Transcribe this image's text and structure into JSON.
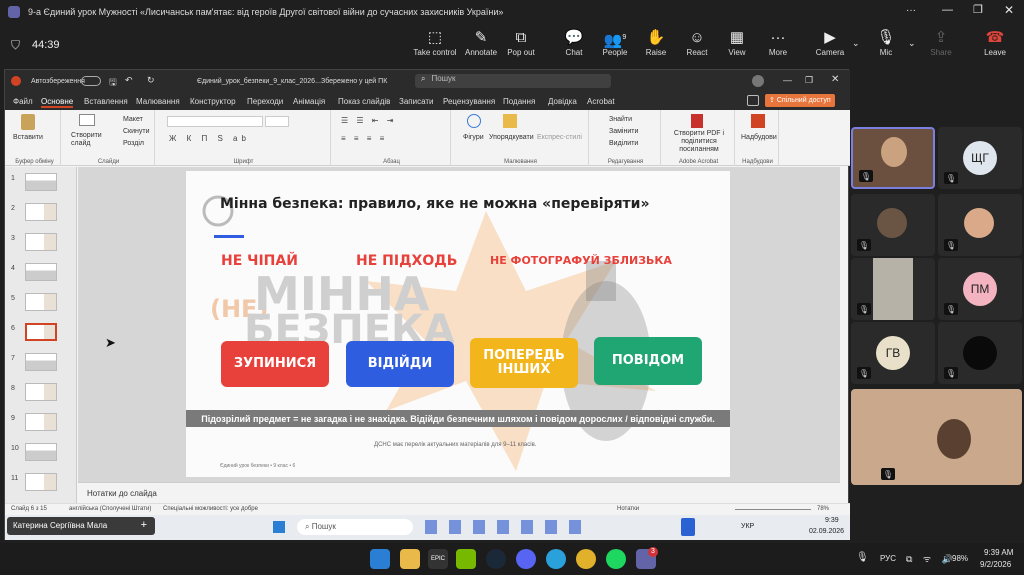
{
  "window": {
    "title": "9-а Єдиний урок Мужності «Лисичанськ пам'ятає: від героїв Другої світової війни до сучасних захисників України»"
  },
  "meeting": {
    "timer": "44:39",
    "buttons": [
      {
        "label": "Take control",
        "icon": "⬚"
      },
      {
        "label": "Annotate",
        "icon": "✎"
      },
      {
        "label": "Pop out",
        "icon": "⧉"
      },
      {
        "label": "Chat",
        "icon": "💬"
      },
      {
        "label": "People",
        "icon": "👥",
        "badge": "9"
      },
      {
        "label": "Raise",
        "icon": "✋"
      },
      {
        "label": "React",
        "icon": "☺"
      },
      {
        "label": "View",
        "icon": "▦"
      },
      {
        "label": "More",
        "icon": "···"
      },
      {
        "label": "Camera",
        "icon": "▶"
      },
      {
        "label": "Mic",
        "icon": "🎙"
      },
      {
        "label": "Share",
        "icon": "⇪"
      },
      {
        "label": "Leave",
        "icon": "☎"
      }
    ]
  },
  "ppt": {
    "autosave": "Автозбереження",
    "doc_title": "Єдиний_урок_безпеки_9_клас_2026...",
    "saved": "Збережено у цей ПК",
    "search": "Пошук",
    "tabs": [
      "Файл",
      "Основне",
      "Вставлення",
      "Малювання",
      "Конструктор",
      "Переходи",
      "Анімація",
      "Показ слайдів",
      "Записати",
      "Рецензування",
      "Подання",
      "Довідка",
      "Acrobat"
    ],
    "share": "Спільний доступ",
    "ribbon": {
      "paste": "Вставити",
      "clipboard": "Буфер обміну",
      "new_slide": "Створити слайд",
      "layout": "Макет",
      "reset": "Скинути",
      "section": "Розділ",
      "slides": "Слайди",
      "font": "Шрифт",
      "paragraph": "Абзац",
      "shapes": "Фігури",
      "arrange": "Упорядкувати",
      "styles": "Експрес-стилі",
      "drawing": "Малювання",
      "find": "Знайти",
      "replace": "Замінити",
      "select": "Виділити",
      "editing": "Редагування",
      "pdf": "Створити PDF і поділитися посиланням",
      "acrobat": "Adobe Acrobat",
      "addins": "Надбудови",
      "addins_grp": "Надбудови"
    },
    "thumb_numbers": [
      "1",
      "2",
      "3",
      "4",
      "5",
      "6",
      "7",
      "8",
      "9",
      "10",
      "11"
    ],
    "notes": "Нотатки до слайда",
    "status": {
      "slide": "Слайд 6 з 15",
      "lang": "англійська (Сполучені Штати)",
      "access": "Спеціальні можливості: усе добре",
      "notes": "Нотатки",
      "zoom": "78%"
    }
  },
  "slide": {
    "title": "Мінна безпека: правило, яке не можна «перевіряти»",
    "rules": [
      "НЕ ЧІПАЙ",
      "НЕ ПІДХОДЬ",
      "НЕ ФОТОГРАФУЙ ЗБЛИЗЬКА"
    ],
    "watermark_top": "(НЕ)",
    "watermark_1": "МІННА",
    "watermark_2": "БЕЗПЕКА",
    "buttons": [
      {
        "label": "ЗУПИНИСЯ",
        "color": "#e8403a"
      },
      {
        "label": "ВІДІЙДИ",
        "color": "#2f5de0"
      },
      {
        "label": "ПОПЕРЕДЬ ІНШИХ",
        "color": "#f2b61c"
      },
      {
        "label": "ПОВІДОМ",
        "color": "#1fa672"
      }
    ],
    "banner": "Підозрілий предмет = не загадка і не знахідка. Відійди безпечним шляхом і повідом дорослих / відповідні служби.",
    "source": "ДСНС має перелік актуальних матеріалів для 9–11 класів.",
    "footer": "Єдиний урок безпеки • 9 клас • 6"
  },
  "inner_taskbar": {
    "user": "Катерина Сергіївна Мала",
    "search": "Пошук",
    "lang": "УКР",
    "time": "9:39",
    "date": "02.09.2026"
  },
  "participants": [
    {
      "initials": "ЩГ",
      "color": "#dfe6ee"
    },
    {
      "initials": "ПМ",
      "color": "#f3b3c0"
    },
    {
      "initials": "ГВ",
      "color": "#e8e0c8"
    }
  ],
  "taskbar": {
    "lang": "РУС",
    "battery": "98%",
    "time": "9:39 AM",
    "date": "9/2/2026",
    "teams_badge": "3"
  }
}
